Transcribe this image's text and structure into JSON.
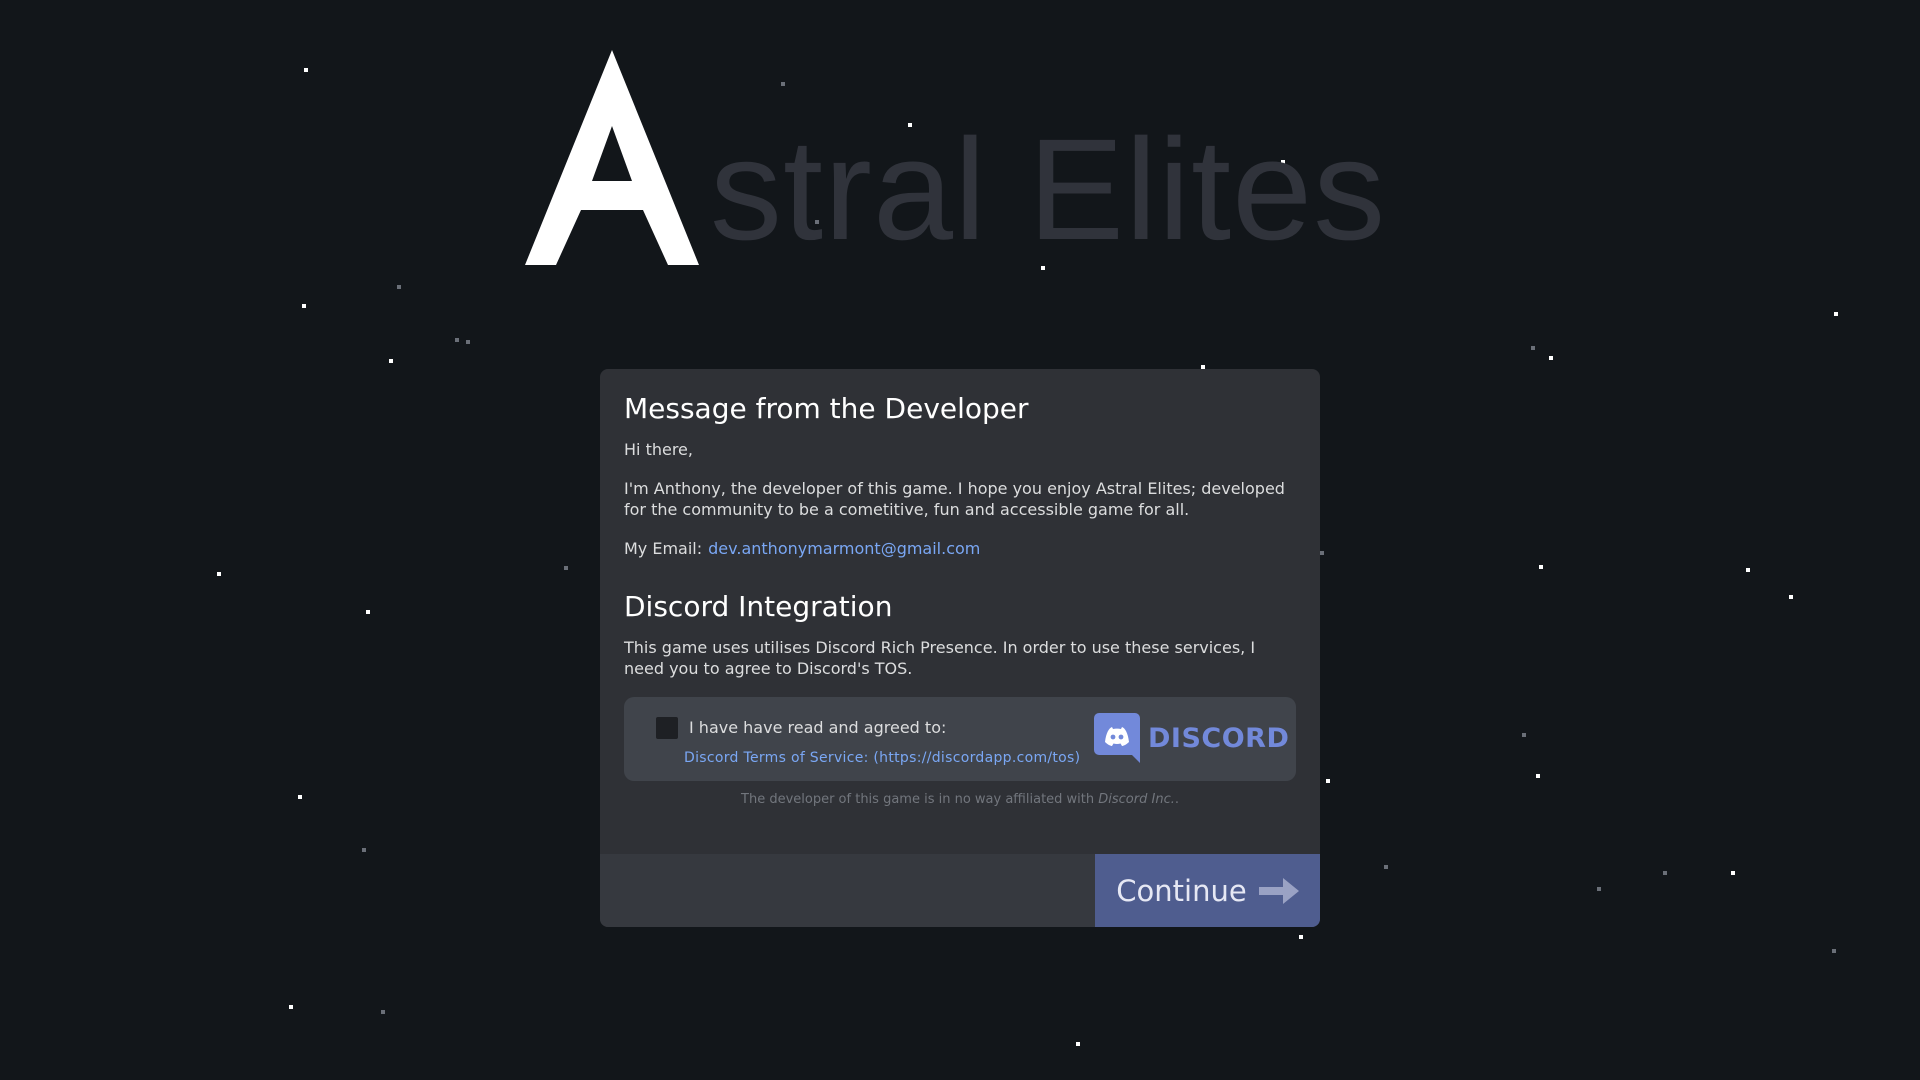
{
  "logo": {
    "first_letter": "A",
    "rest": "stral Elites"
  },
  "dialog": {
    "developer_heading": "Message from the Developer",
    "greeting": "Hi there,",
    "intro": "I'm Anthony, the developer of this game. I hope you enjoy Astral Elites; developed for the community to be a cometitive, fun and accessible game for all.",
    "email_label": "My Email:",
    "email_value": "dev.anthonymarmont@gmail.com",
    "discord_heading": "Discord Integration",
    "discord_text": "This game uses utilises Discord Rich Presence. In order to use these services, I need you to agree to Discord's TOS.",
    "agree_label": "I have have read and agreed to:",
    "tos_link": "Discord Terms of Service: (https://discordapp.com/tos)",
    "discord_wordmark": "DISCORD",
    "disclaimer_prefix": "The developer of this game is in no way affiliated with",
    "disclaimer_company": "Discord Inc.",
    "disclaimer_suffix": ".",
    "checkbox_checked": false
  },
  "footer": {
    "continue_label": "Continue"
  },
  "colors": {
    "background": "#12161a",
    "dialog": "#2f3136",
    "accent_button": "#4f5d8f",
    "link": "#7aa7f4",
    "discord_brand": "#7289da"
  },
  "icons": {
    "continue": "arrow-right-icon",
    "discord": "discord-logo-icon"
  }
}
